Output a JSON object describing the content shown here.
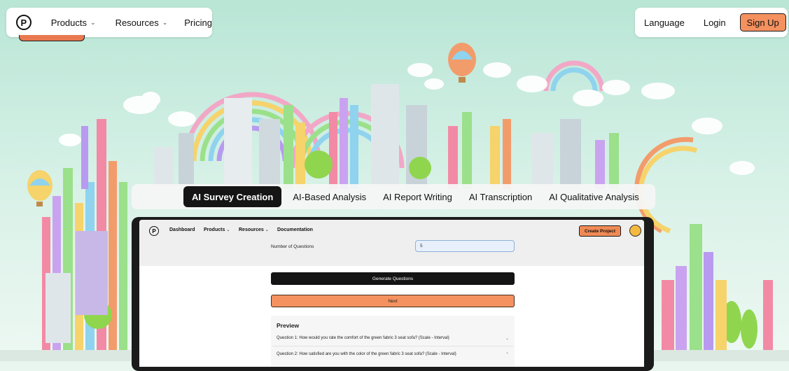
{
  "top_nav": {
    "logo_letter": "P",
    "products_label": "Products",
    "resources_label": "Resources",
    "pricing_label": "Pricing",
    "language_label": "Language",
    "login_label": "Login",
    "signup_label": "Sign Up"
  },
  "tabs": {
    "items": [
      {
        "label": "AI Survey Creation",
        "active": true
      },
      {
        "label": "AI-Based Analysis",
        "active": false
      },
      {
        "label": "AI Report Writing",
        "active": false
      },
      {
        "label": "AI Transcription",
        "active": false
      },
      {
        "label": "AI Qualitative Analysis",
        "active": false
      }
    ]
  },
  "app": {
    "logo_letter": "P",
    "nav_dashboard": "Dashboard",
    "nav_products": "Products",
    "nav_resources": "Resources",
    "nav_documentation": "Documentation",
    "create_project_label": "Create Project",
    "number_of_questions_label": "Number of Questions",
    "number_of_questions_value": "5",
    "generate_label": "Generate Questions",
    "next_label": "Next",
    "preview_title": "Preview",
    "questions": [
      "Question 1: How would you rate the comfort of the green fabric 3 seat sofa? (Scale - Interval)",
      "Question 2: How satisfied are you with the color of the green fabric 3 seat sofa? (Scale - Interval)"
    ]
  },
  "colors": {
    "accent_orange": "#f4915f",
    "dark": "#151515",
    "sky": "#cfeee3"
  },
  "icons": [
    "chevron-down-icon",
    "logo-icon",
    "avatar-icon",
    "hero-city-illustration"
  ]
}
